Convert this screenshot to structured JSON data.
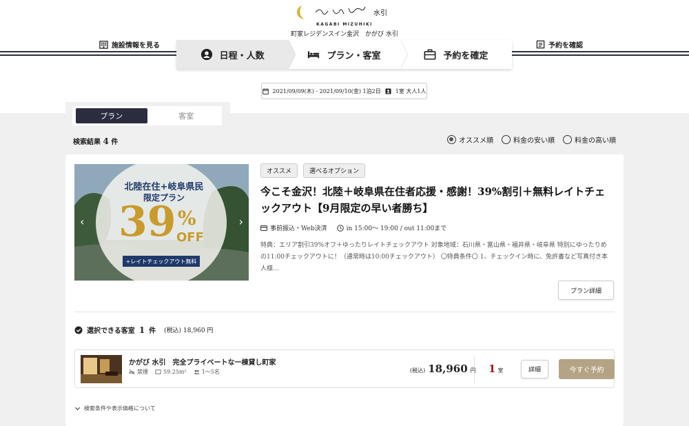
{
  "brand": {
    "logo_kana": "かがび",
    "logo_kanji": "水引",
    "roman": "KAGABI MIZUHIKI",
    "subtitle": "町家レジデンスイン金沢　かがび 水引"
  },
  "header": {
    "facility_link": "施設情報を見る",
    "reservation_link": "予約を確認"
  },
  "steps": [
    {
      "label": "日程・人数",
      "icon": "user-icon",
      "active": true
    },
    {
      "label": "プラン・客室",
      "icon": "bed-icon",
      "active": false
    },
    {
      "label": "予約を確定",
      "icon": "briefcase-icon",
      "active": false
    }
  ],
  "search": {
    "dates": "2021/09/09(木) - 2021/09/10(金) 1泊2日",
    "guests": "1室 大人1人"
  },
  "tabs": {
    "plan": "プラン",
    "room": "客室"
  },
  "results": {
    "label": "検索結果",
    "count": "4",
    "unit": "件"
  },
  "sort": {
    "recommended": "オススメ順",
    "low_price": "料金の安い順",
    "high_price": "料金の高い順",
    "selected": "recommended"
  },
  "plan": {
    "image": {
      "line1": "北陸在住+岐阜県民",
      "line2": "限定プラン",
      "percent": "39",
      "percent_sign": "%",
      "off": "OFF",
      "tag": "+レイトチェックアウト無料"
    },
    "badges": [
      "オススメ",
      "選べるオプション"
    ],
    "title": "今こそ金沢！北陸＋岐阜県在住者応援・感謝！39%割引＋無料レイトチェックアウト【9月限定の早い者勝ち】",
    "payment": "事前振込・Web決済",
    "checkin": "in 15:00～ 19:00 / out 11:00まで",
    "description": "特典：エリア割引39%オフ＋ゆったりレイトチェックアウト 対象地域：石川県・富山県・福井県・岐阜県 特別にゆったりめの11:00チェックアウトに！（通常時は10:00チェックアウト） 〇特典条件〇 1、チェックイン時に、免許書など写真付き本人様...",
    "detail_button": "プラン詳細"
  },
  "rooms_section": {
    "label": "選択できる客室",
    "count": "1",
    "unit": "件",
    "price_note": "(税込) 18,960 円"
  },
  "room": {
    "name": "かがび 水引　完全プライベートな一棟貸し町家",
    "smoking": "禁煙",
    "area": "59.25m²",
    "capacity": "1～5名",
    "tax_label": "(税込)",
    "price": "18,960",
    "yen": "円",
    "qty": "1",
    "qty_unit": "室",
    "detail_button": "詳細",
    "book_button": "今すぐ予約"
  },
  "footer_note": "検索条件や表示価格について",
  "colors": {
    "navy": "#2a2d3e",
    "gold": "#c99b2c",
    "book_button": "#b5a385",
    "qty_red": "#a01818",
    "panel_bg": "#f0f0f1"
  }
}
